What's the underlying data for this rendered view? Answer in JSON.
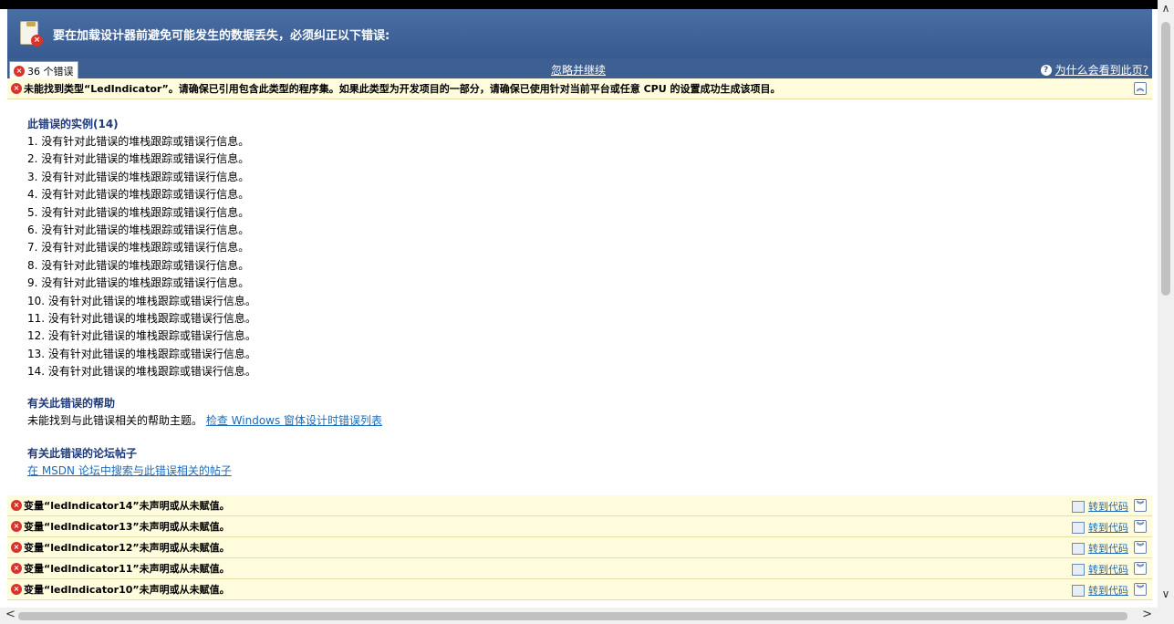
{
  "header": {
    "title": "要在加载设计器前避免可能发生的数据丢失，必须纠正以下错误:"
  },
  "subbar": {
    "error_count": "36 个错误",
    "ignore": "忽略并继续",
    "why": "为什么会看到此页?"
  },
  "main_error": {
    "text": "未能找到类型“LedIndicator”。请确保已引用包含此类型的程序集。如果此类型为开发项目的一部分，请确保已使用针对当前平台或任意 CPU 的设置成功生成该项目。"
  },
  "details": {
    "instances_title": "此错误的实例(14)",
    "instances": [
      "1.  没有针对此错误的堆栈跟踪或错误行信息。",
      "2.  没有针对此错误的堆栈跟踪或错误行信息。",
      "3.  没有针对此错误的堆栈跟踪或错误行信息。",
      "4.  没有针对此错误的堆栈跟踪或错误行信息。",
      "5.  没有针对此错误的堆栈跟踪或错误行信息。",
      "6.  没有针对此错误的堆栈跟踪或错误行信息。",
      "7.  没有针对此错误的堆栈跟踪或错误行信息。",
      "8.  没有针对此错误的堆栈跟踪或错误行信息。",
      "9.  没有针对此错误的堆栈跟踪或错误行信息。",
      "10.  没有针对此错误的堆栈跟踪或错误行信息。",
      "11.  没有针对此错误的堆栈跟踪或错误行信息。",
      "12.  没有针对此错误的堆栈跟踪或错误行信息。",
      "13.  没有针对此错误的堆栈跟踪或错误行信息。",
      "14.  没有针对此错误的堆栈跟踪或错误行信息。"
    ],
    "help_title": "有关此错误的帮助",
    "help_text": "未能找到与此错误相关的帮助主题。",
    "help_link": "检查 Windows 窗体设计时错误列表",
    "forum_title": "有关此错误的论坛帖子",
    "forum_link": "在 MSDN 论坛中搜索与此错误相关的帖子"
  },
  "errors": [
    {
      "text": "变量“ledIndicator14”未声明或从未赋值。",
      "goto": "转到代码"
    },
    {
      "text": "变量“ledIndicator13”未声明或从未赋值。",
      "goto": "转到代码"
    },
    {
      "text": "变量“ledIndicator12”未声明或从未赋值。",
      "goto": "转到代码"
    },
    {
      "text": "变量“ledIndicator11”未声明或从未赋值。",
      "goto": "转到代码"
    },
    {
      "text": "变量“ledIndicator10”未声明或从未赋值。",
      "goto": "转到代码"
    }
  ],
  "icons": {
    "error": "error-icon",
    "clipboard": "clipboard-error-icon",
    "help": "help-icon",
    "collapse": "chevron-up-icon",
    "expand": "chevron-down-icon",
    "goto": "code-icon"
  },
  "colors": {
    "header": "#4a6fa5",
    "error_row": "#fffbdd",
    "link": "#1c6bb8",
    "section_title": "#1f3a7a"
  }
}
